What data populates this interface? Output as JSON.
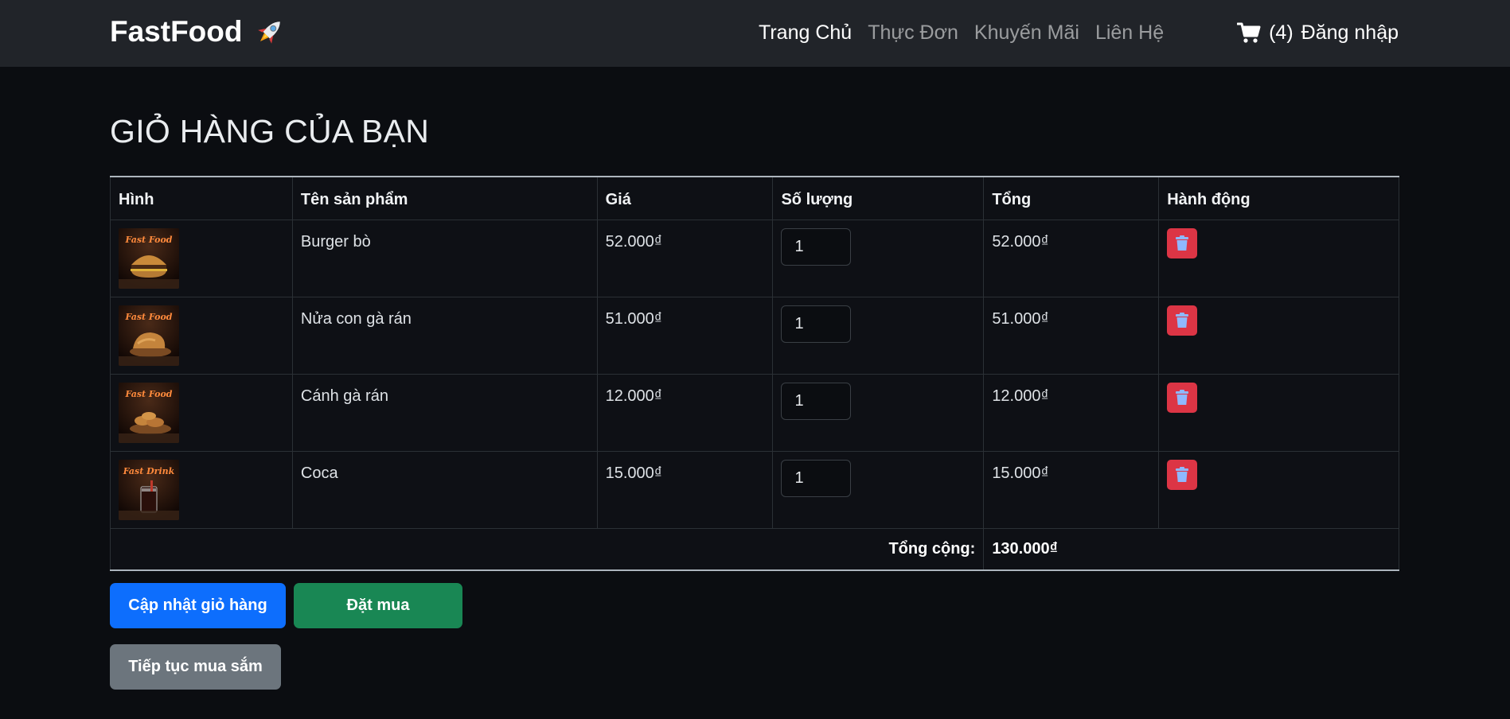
{
  "navbar": {
    "brand": "FastFood",
    "brand_icon": "rocket-emoji-icon",
    "links": [
      {
        "label": "Trang Chủ",
        "active": true
      },
      {
        "label": "Thực Đơn",
        "active": false
      },
      {
        "label": "Khuyến Mãi",
        "active": false
      },
      {
        "label": "Liên Hệ",
        "active": false
      }
    ],
    "cart_count": "(4)",
    "login_label": "Đăng nhập"
  },
  "page": {
    "title": "GIỎ HÀNG CỦA BẠN"
  },
  "table": {
    "headers": {
      "image": "Hình",
      "name": "Tên sản phẩm",
      "price": "Giá",
      "qty": "Số lượng",
      "total": "Tổng",
      "action": "Hành động"
    },
    "rows": [
      {
        "image_label": "Fast Food",
        "name": "Burger bò",
        "price": "52.000₫",
        "qty": "1",
        "total": "52.000₫"
      },
      {
        "image_label": "Fast Food",
        "name": "Nửa con gà rán",
        "price": "51.000₫",
        "qty": "1",
        "total": "51.000₫"
      },
      {
        "image_label": "Fast Food",
        "name": "Cánh gà rán",
        "price": "12.000₫",
        "qty": "1",
        "total": "12.000₫"
      },
      {
        "image_label": "Fast Drink",
        "name": "Coca",
        "price": "15.000₫",
        "qty": "1",
        "total": "15.000₫"
      }
    ],
    "grand_total_label": "Tổng cộng:",
    "grand_total_value": "130.000₫"
  },
  "buttons": {
    "update": "Cập nhật giỏ hàng",
    "order": "Đặt mua",
    "continue": "Tiếp tục mua sắm"
  },
  "colors": {
    "navbar_bg": "#212429",
    "page_bg": "#0b0d11",
    "primary": "#0d6efd",
    "success": "#198754",
    "secondary": "#6c757d",
    "danger": "#dc3545"
  }
}
